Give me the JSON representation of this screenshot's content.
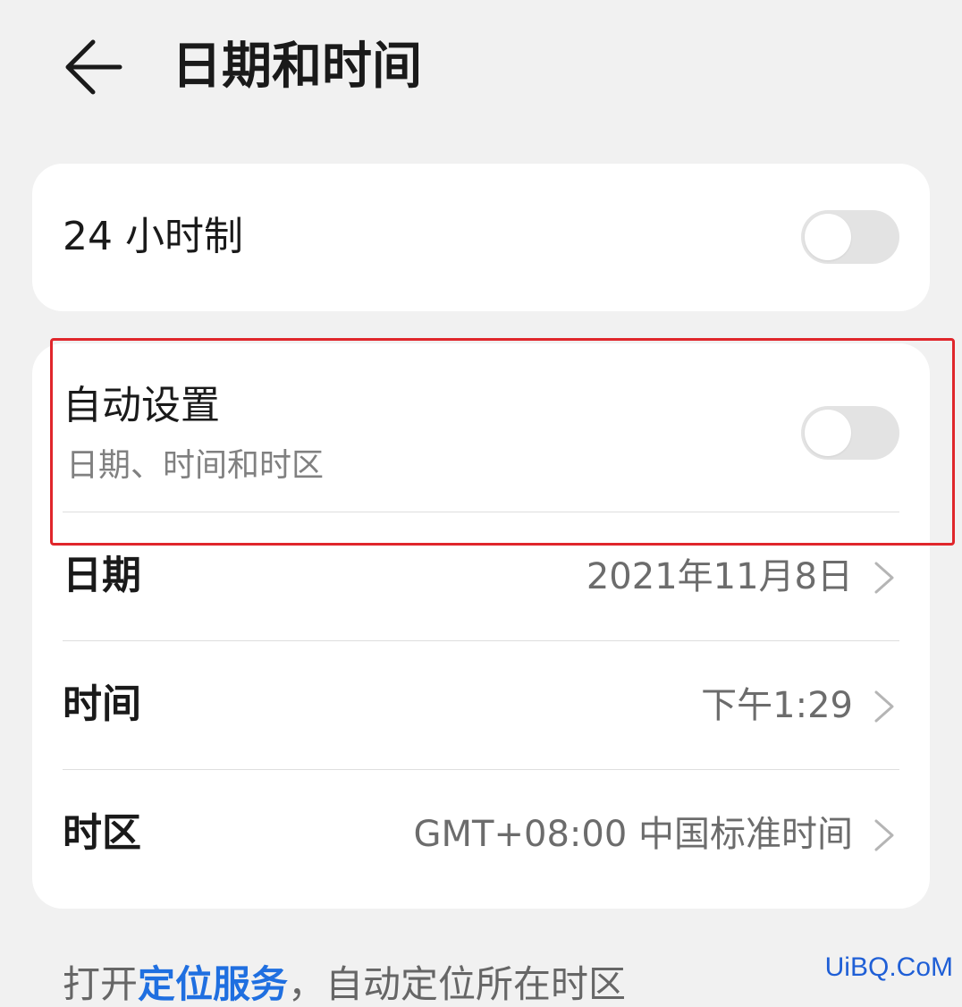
{
  "header": {
    "title": "日期和时间",
    "back_icon": "arrow-left-icon"
  },
  "settings": {
    "hour24": {
      "label": "24 小时制",
      "enabled": false
    },
    "auto": {
      "label": "自动设置",
      "subtitle": "日期、时间和时区",
      "enabled": false
    },
    "date": {
      "label": "日期",
      "value": "2021年11月8日"
    },
    "time": {
      "label": "时间",
      "value": "下午1:29"
    },
    "timezone": {
      "label": "时区",
      "value": "GMT+08:00 中国标准时间"
    }
  },
  "footer": {
    "prefix": "打开",
    "link": "定位服务",
    "suffix": "，自动定位所在时区"
  },
  "watermark": "UiBQ.CoM",
  "colors": {
    "background": "#f1f1f1",
    "card": "#ffffff",
    "toggle_off": "#e3e3e3",
    "highlight": "#e0262b",
    "link": "#1f6fe0"
  }
}
